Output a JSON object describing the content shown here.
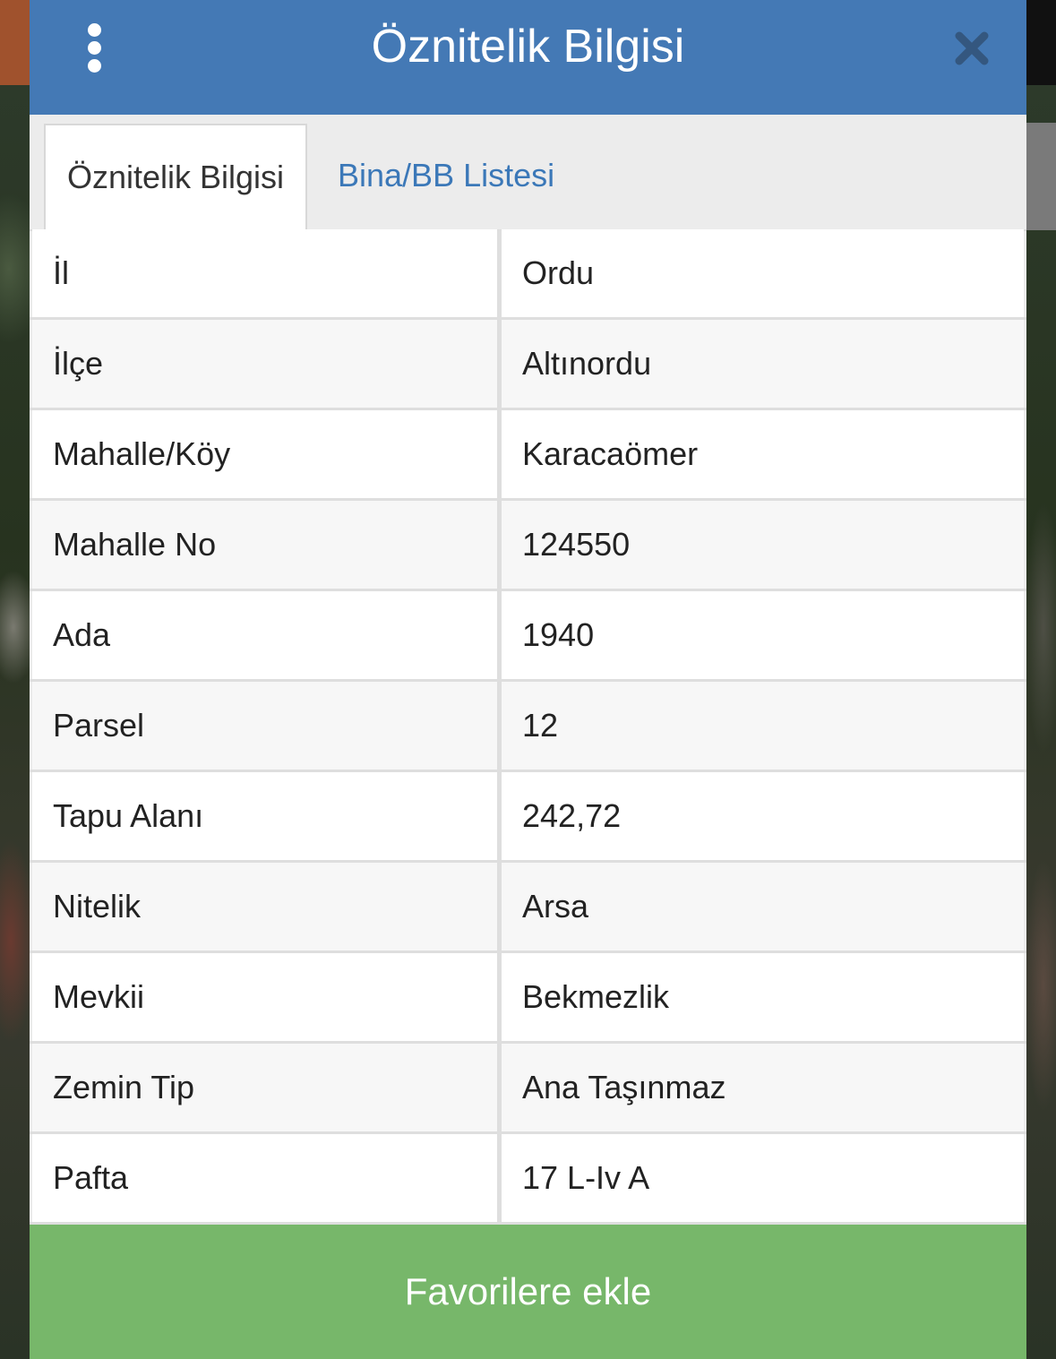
{
  "header": {
    "title": "Öznitelik Bilgisi",
    "menu_icon": "more-vertical-icon",
    "close_icon": "close-icon",
    "background_color": "#4479b5"
  },
  "tabs": [
    {
      "label": "Öznitelik Bilgisi",
      "active": true
    },
    {
      "label": "Bina/BB Listesi",
      "active": false
    }
  ],
  "attributes": [
    {
      "key": "İl",
      "value": "Ordu"
    },
    {
      "key": "İlçe",
      "value": "Altınordu"
    },
    {
      "key": "Mahalle/Köy",
      "value": "Karacaömer"
    },
    {
      "key": "Mahalle No",
      "value": "124550"
    },
    {
      "key": "Ada",
      "value": "1940"
    },
    {
      "key": "Parsel",
      "value": "12"
    },
    {
      "key": "Tapu Alanı",
      "value": "242,72"
    },
    {
      "key": "Nitelik",
      "value": "Arsa"
    },
    {
      "key": "Mevkii",
      "value": "Bekmezlik"
    },
    {
      "key": "Zemin Tip",
      "value": "Ana Taşınmaz"
    },
    {
      "key": "Pafta",
      "value": "17 L-Iv A"
    }
  ],
  "footer": {
    "favorite_label": "Favorilere ekle",
    "button_color": "#77b76a"
  }
}
